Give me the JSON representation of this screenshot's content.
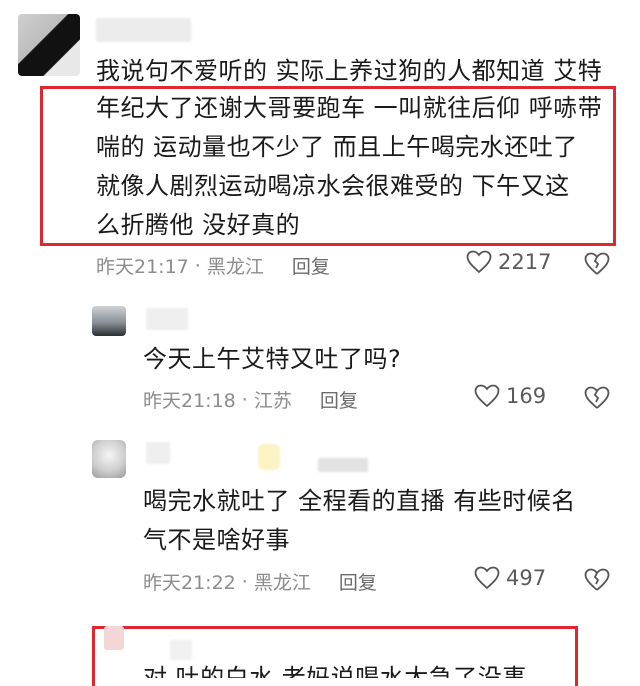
{
  "comments": [
    {
      "text_line1": "我说句不爱听的 实际上养过狗的人都知道 艾特",
      "text_line2": "年纪大了还谢大哥要跑车 一叫就往后仰 呼哧带",
      "text_line3": "喘的 运动量也不少了 而且上午喝完水还吐了",
      "text_line4": "就像人剧烈运动喝凉水会很难受的  下午又这",
      "text_line5": "么折腾他 没好真的",
      "time": "昨天21:17",
      "location": "黑龙江",
      "reply": "回复",
      "likes": "2217"
    },
    {
      "text_line1": "今天上午艾特又吐了吗?",
      "time": "昨天21:18",
      "location": "江苏",
      "reply": "回复",
      "likes": "169"
    },
    {
      "text_line1": "喝完水就吐了 全程看的直播 有些时候名",
      "text_line2": "气不是啥好事",
      "time": "昨天21:22",
      "location": "黑龙江",
      "reply": "回复",
      "likes": "497"
    }
  ],
  "separator": "·",
  "partial_text": "对 吐的白水 老妈说喝水太急了没事"
}
